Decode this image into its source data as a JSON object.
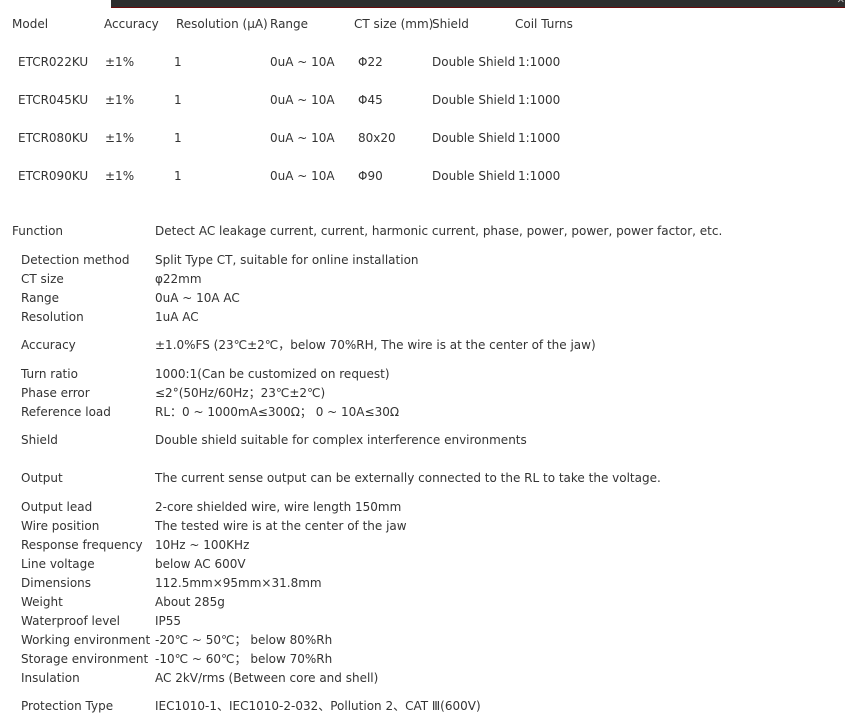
{
  "table": {
    "headers": [
      "Model",
      "Accuracy",
      "Resolution (μA)",
      "Range",
      "CT size (mm)",
      "Shield",
      "Coil Turns"
    ],
    "rows": [
      [
        "ETCR022KU",
        "±1%",
        "1",
        "0uA ~ 10A",
        "Φ22",
        "Double Shield",
        "1:1000"
      ],
      [
        "ETCR045KU",
        "±1%",
        "1",
        "0uA ~ 10A",
        "Φ45",
        "Double Shield",
        "1:1000"
      ],
      [
        "ETCR080KU",
        "±1%",
        "1",
        "0uA ~ 10A",
        "80x20",
        "Double Shield",
        "1:1000"
      ],
      [
        "ETCR090KU",
        "±1%",
        "1",
        "0uA ~ 10A",
        "Φ90",
        "Double Shield",
        "1:1000"
      ]
    ]
  },
  "specs": [
    {
      "label": "Function",
      "value": "Detect AC leakage current, current, harmonic current, phase, power, power, power factor, etc."
    },
    {
      "label": "Detection method",
      "value": "Split Type CT, suitable for online installation"
    },
    {
      "label": "CT size",
      "value": "φ22mm"
    },
    {
      "label": "Range",
      "value": "0uA ~ 10A AC"
    },
    {
      "label": "Resolution",
      "value": "1uA AC"
    },
    {
      "label": "Accuracy",
      "value": "±1.0%FS (23℃±2℃，below 70%RH, The wire is at the center of the jaw)"
    },
    {
      "label": "Turn ratio",
      "value": "1000:1(Can be customized on request)"
    },
    {
      "label": "Phase error",
      "value": "≤2°(50Hz/60Hz；23℃±2℃)"
    },
    {
      "label": "Reference load",
      "value": "RL：0 ~ 1000mA≤300Ω； 0 ~ 10A≤30Ω"
    },
    {
      "label": "Shield",
      "value": "Double shield suitable for complex interference environments"
    },
    {
      "label": "Output",
      "value": "The current sense output can be externally connected to the RL to take the voltage."
    },
    {
      "label": "Output lead",
      "value": "2-core shielded wire, wire length 150mm"
    },
    {
      "label": "Wire position",
      "value": "The tested wire is at the center of the jaw"
    },
    {
      "label": "Response frequency",
      "value": "10Hz ~ 100KHz"
    },
    {
      "label": "Line voltage",
      "value": "below AC 600V"
    },
    {
      "label": "Dimensions",
      "value": "112.5mm×95mm×31.8mm"
    },
    {
      "label": "Weight",
      "value": "About 285g"
    },
    {
      "label": "Waterproof level",
      "value": "IP55"
    },
    {
      "label": "Working environment",
      "value": "-20℃ ~ 50℃； below 80%Rh"
    },
    {
      "label": "Storage environment",
      "value": "-10℃ ~ 60℃； below 70%Rh"
    },
    {
      "label": "Insulation",
      "value": "AC 2kV/rms (Between core and shell)"
    },
    {
      "label": "Protection Type",
      "value": "IEC1010-1、IEC1010-2-032、Pollution 2、CAT Ⅲ(600V)"
    }
  ],
  "colors": {
    "text": "#333333",
    "topbar": "#2e2e2e",
    "topbar_border": "#6a0b0b"
  },
  "icons": {
    "topbar_close": "close-icon"
  }
}
